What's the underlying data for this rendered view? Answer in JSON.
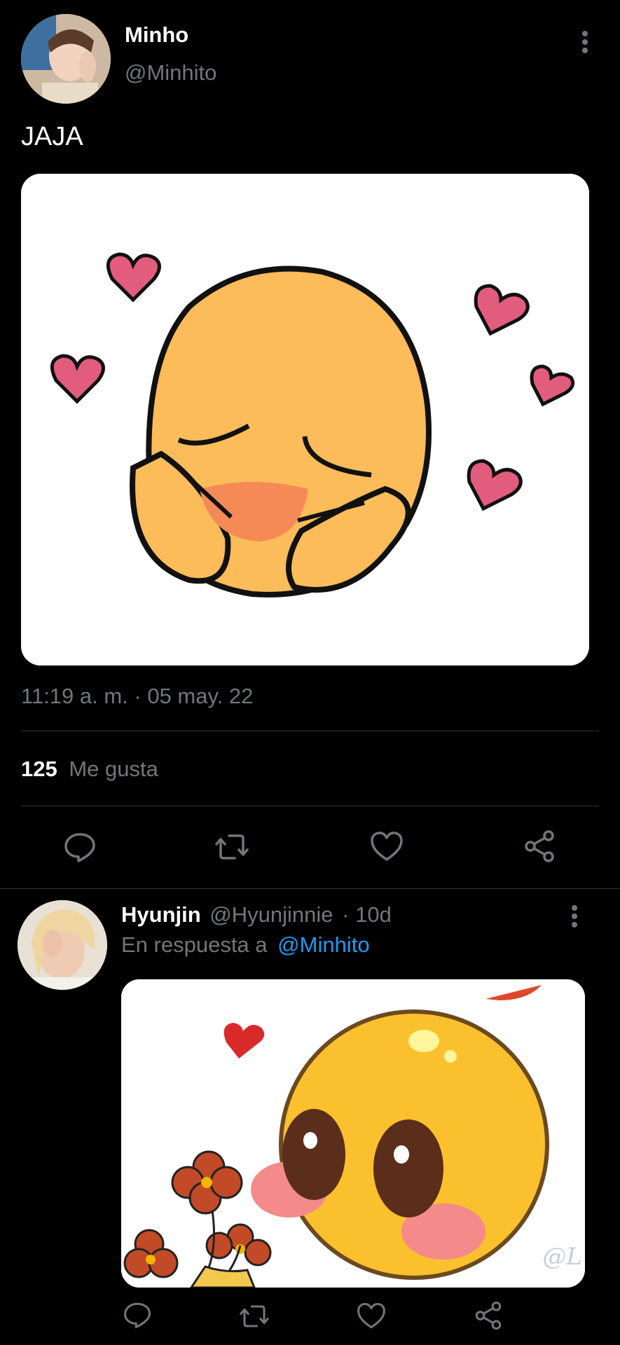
{
  "tweet": {
    "author_name": "Minho",
    "author_handle": "@Minhito",
    "text": "JAJA",
    "timestamp": "11:19 a. m. · 05 may. 22",
    "likes_count": "125",
    "likes_label": "Me gusta"
  },
  "reply": {
    "author_name": "Hyunjin",
    "author_handle": "@Hyunjinnie",
    "time": "· 10d",
    "reply_prefix": "En respuesta a",
    "reply_to": "@Minhito",
    "watermark": "@L"
  },
  "colors": {
    "background": "#000000",
    "muted": "#71767b",
    "link": "#1d9bf0",
    "divider": "#2f3336"
  },
  "icons": [
    "more-icon",
    "reply-icon",
    "retweet-icon",
    "like-icon",
    "share-icon"
  ]
}
